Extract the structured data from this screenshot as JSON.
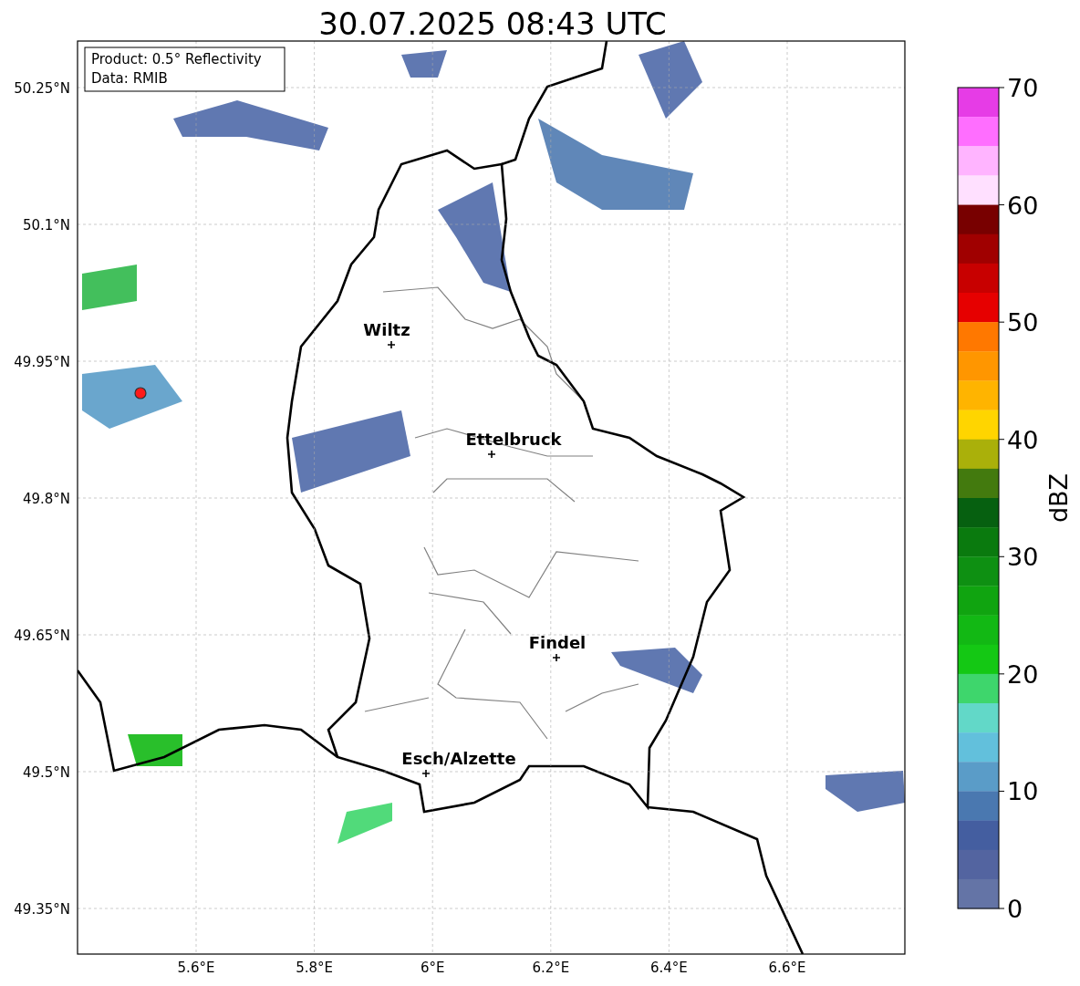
{
  "title": "30.07.2025 08:43 UTC",
  "legend": [
    "Product: 0.5° Reflectivity",
    "Data: RMIB"
  ],
  "map": {
    "yticks": [
      "50.25°N",
      "50.1°N",
      "49.95°N",
      "49.8°N",
      "49.65°N",
      "49.5°N",
      "49.35°N"
    ],
    "xticks": [
      "5.6°E",
      "5.8°E",
      "6°E",
      "6.2°E",
      "6.4°E",
      "6.6°E"
    ],
    "cities": [
      {
        "name": "Wiltz"
      },
      {
        "name": "Ettelbruck"
      },
      {
        "name": "Findel"
      },
      {
        "name": "Esch/Alzette"
      }
    ]
  },
  "colorbar": {
    "label": "dBZ",
    "ticks": [
      "70",
      "60",
      "50",
      "40",
      "30",
      "20",
      "10",
      "0"
    ],
    "bins": [
      {
        "color": "#e63ce6"
      },
      {
        "color": "#ff6eff"
      },
      {
        "color": "#ffb4ff"
      },
      {
        "color": "#ffe0ff"
      },
      {
        "color": "#780000"
      },
      {
        "color": "#a00000"
      },
      {
        "color": "#c80000"
      },
      {
        "color": "#e60000"
      },
      {
        "color": "#ff7800"
      },
      {
        "color": "#ff9600"
      },
      {
        "color": "#ffb400"
      },
      {
        "color": "#ffd500"
      },
      {
        "color": "#aab00a"
      },
      {
        "color": "#437a0e"
      },
      {
        "color": "#066010"
      },
      {
        "color": "#0a7a0e"
      },
      {
        "color": "#0e9012"
      },
      {
        "color": "#10a410"
      },
      {
        "color": "#12b814"
      },
      {
        "color": "#14c814"
      },
      {
        "color": "#3ed66c"
      },
      {
        "color": "#62d8c8"
      },
      {
        "color": "#62c0dc"
      },
      {
        "color": "#5a9cc8"
      },
      {
        "color": "#4a78b0"
      },
      {
        "color": "#445ea0"
      },
      {
        "color": "#5364a0"
      },
      {
        "color": "#6474a6"
      }
    ]
  }
}
